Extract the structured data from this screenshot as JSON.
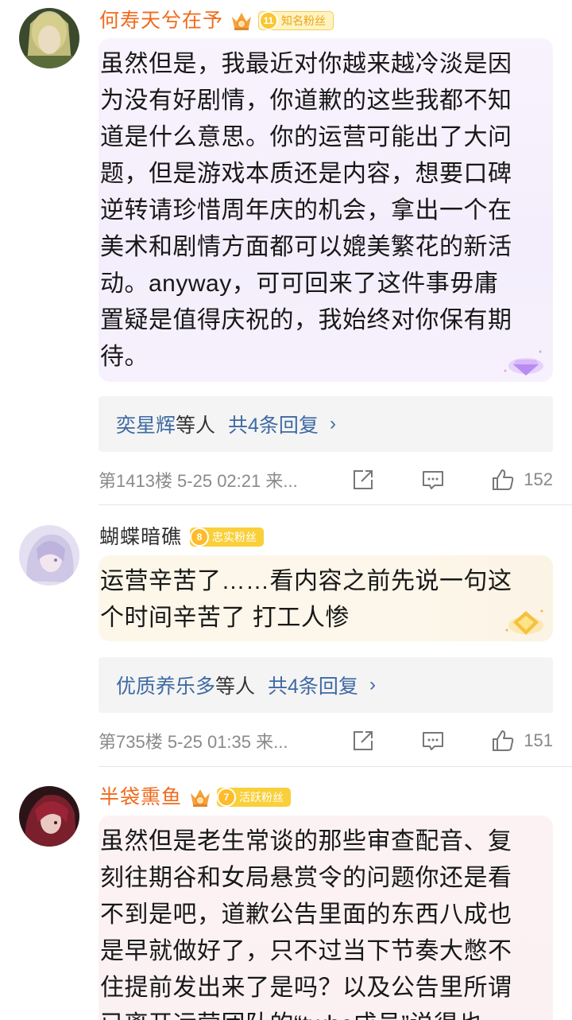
{
  "comments": [
    {
      "username": "何寿天兮在予",
      "fan_badge": {
        "level": "11",
        "label": "知名粉丝"
      },
      "text": "虽然但是，我最近对你越来越冷淡是因为没有好剧情，你道歉的这些我都不知道是什么意思。你的运营可能出了大问题，但是游戏本质还是内容，想要口碑逆转请珍惜周年庆的机会，拿出一个在美术和剧情方面都可以媲美繁花的新活动。anyway，可可回来了这件事毋庸置疑是值得庆祝的，我始终对你保有期待。",
      "lines": [
        "虽然但是，我最近对你越来越冷淡是因",
        "为没有好剧情，你道歉的这些我都不知",
        "道是什么意思。你的运营可能出了大问",
        "题，但是游戏本质还是内容，想要口碑",
        "逆转请珍惜周年庆的机会，拿出一个在",
        "美术和剧情方面都可以媲美繁花的新活",
        "动。anyway，可可回来了这件事毋庸",
        "置疑是值得庆祝的，我始终对你保有期",
        "待。"
      ],
      "reply_who": "奕星辉",
      "reply_etc": "等人",
      "reply_count": "共4条回复",
      "meta": "第1413楼  5-25 02:21  来...",
      "likes": "152"
    },
    {
      "username": "蝴蝶暗礁",
      "fan_badge": {
        "level": "8",
        "label": "忠实粉丝"
      },
      "lines": [
        "运营辛苦了……看内容之前先说一句这",
        "个时间辛苦了 打工人惨"
      ],
      "reply_who": "优质养乐多",
      "reply_etc": "等人",
      "reply_count": "共4条回复",
      "meta": "第735楼  5-25 01:35  来...",
      "likes": "151"
    },
    {
      "username": "半袋熏鱼",
      "fan_badge": {
        "level": "7",
        "label": "活跃粉丝"
      },
      "lines": [
        "虽然但是老生常谈的那些审查配音、复",
        "刻往期谷和女局悬赏令的问题你还是看",
        "不到是吧，道歉公告里面的东西八成也",
        "是早就做好了，只不过当下节奏大憋不",
        "住提前发出来了是吗？以及公告里所谓",
        "已离开运营团队的“twbc成员”说得也"
      ]
    }
  ],
  "chevron": "›",
  "icons": [
    "crown-icon",
    "share-icon",
    "comment-icon",
    "like-icon",
    "diamond-icon",
    "gem-icon"
  ],
  "colors": {
    "username_orange": "#f06a1b",
    "link_blue": "#3e6aa3",
    "badge_yellow": "#f9cf3a"
  }
}
